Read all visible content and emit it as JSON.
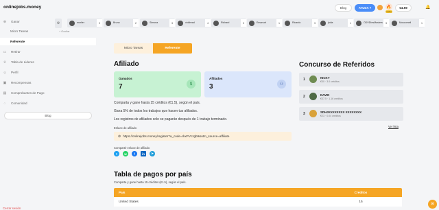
{
  "app": {
    "logo": "onlinejobs.money"
  },
  "sidebar": {
    "ganar": "Ganar",
    "items": [
      {
        "label": "Micro Tareas",
        "icon": "",
        "sub": true
      },
      {
        "label": "Referente",
        "icon": "",
        "sub": true,
        "active": true
      },
      {
        "label": "Retirar",
        "icon": "wallet-icon"
      },
      {
        "label": "Tabla de Lideres",
        "icon": "trophy-icon"
      },
      {
        "label": "Perfil",
        "icon": "user-icon"
      },
      {
        "label": "Recompensas",
        "icon": "gift-icon"
      },
      {
        "label": "Comprobantes de Pago",
        "icon": "receipt-icon"
      },
      {
        "label": "Comunidad",
        "icon": "chat-icon"
      }
    ],
    "blog": "Blog",
    "cloud": "Cerrar sesión"
  },
  "topbar": {
    "blog": "Blog",
    "ayuda": "AYUDA ?",
    "streak": "racha",
    "balance": "€4.59"
  },
  "ticker": {
    "ocultar": "+ Ocultar",
    "cards": [
      {
        "name": "moriler",
        "num": "9"
      },
      {
        "name": "Bruno",
        "num": "2"
      },
      {
        "name": "Simona",
        "num": "3"
      },
      {
        "name": "viddread",
        "num": "4"
      },
      {
        "name": "Richard",
        "num": "3"
      },
      {
        "name": "Emanuel",
        "num": "1"
      },
      {
        "name": "Ricardo",
        "num": "3"
      },
      {
        "name": "lydia",
        "num": "1"
      },
      {
        "name": "ODVDIesMasters",
        "num": "3"
      },
      {
        "name": "Muscomeil",
        "num": "1"
      }
    ]
  },
  "tabs": {
    "micro": "Micro Tareas",
    "referente": "Referente"
  },
  "afiliado": {
    "title": "Afiliado",
    "ganados_label": "Ganados",
    "ganados_value": "7",
    "afiliados_label": "Afiliados",
    "afiliados_value": "3",
    "p1": "Comparta y gane hasta 15 créditos (€1.5), según el país.",
    "p2": "Gana 5% de todos los trabajos que hacen tus afiliados.",
    "p3": "Los registros de afiliados solo se pagarán después de 1 trabajo terminado.",
    "enlace_label": "Enlace de afiliado",
    "link": "https://onlinejobs.money/register?a_code=rkxPVczgb9&utm_source=affiliate",
    "share_label": "Compartir enlace de afiliado"
  },
  "concurso": {
    "title": "Concurso de Referidos",
    "items": [
      {
        "pos": "1",
        "name": "NICKY",
        "stats": "€30 · 3.0 créditos"
      },
      {
        "pos": "2",
        "name": "DAVID",
        "stats": "€37.5 · 1.16 créditos"
      },
      {
        "pos": "3",
        "name": "SDHJKXXXXXXX XXXXXXXX",
        "stats": "€23 · 0.04 créditos"
      }
    ],
    "ver_lista": "Ver lista"
  },
  "tabla": {
    "title": "Tabla de pagos por país",
    "subtitle": "Comparta y gane hasta 15 créditos (€1.5), según el país.",
    "col_pais": "País",
    "col_creditos": "Créditos",
    "rows": [
      {
        "pais": "United States",
        "creditos": "15"
      }
    ]
  },
  "colors": {
    "accent": "#f5a524",
    "green_card": "#c7f2d3",
    "blue_card": "#dbe6fb",
    "link_blue": "#4a8df8"
  }
}
